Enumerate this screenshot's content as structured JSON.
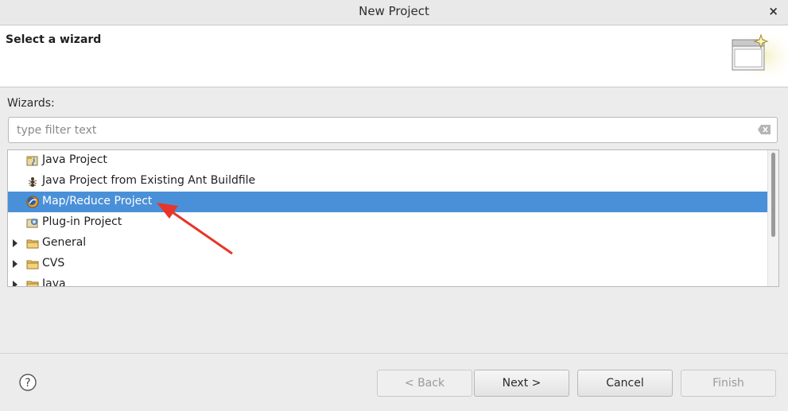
{
  "window": {
    "title": "New Project",
    "close_glyph": "×"
  },
  "header": {
    "heading": "Select a wizard",
    "banner_icon": "new-wizard-banner-icon"
  },
  "wizards_label": "Wizards:",
  "filter": {
    "value": "",
    "placeholder": "type filter text",
    "clear_icon": "clear-icon"
  },
  "tree": {
    "items": [
      {
        "label": "Java Project",
        "icon": "java-project-icon",
        "expandable": false,
        "selected": false
      },
      {
        "label": "Java Project from Existing Ant Buildfile",
        "icon": "ant-icon",
        "expandable": false,
        "selected": false
      },
      {
        "label": "Map/Reduce Project",
        "icon": "mapreduce-project-icon",
        "expandable": false,
        "selected": true
      },
      {
        "label": "Plug-in Project",
        "icon": "plugin-project-icon",
        "expandable": false,
        "selected": false
      },
      {
        "label": "General",
        "icon": "folder-icon",
        "expandable": true,
        "selected": false
      },
      {
        "label": "CVS",
        "icon": "folder-icon",
        "expandable": true,
        "selected": false
      },
      {
        "label": "Java",
        "icon": "folder-icon",
        "expandable": true,
        "selected": false
      }
    ]
  },
  "buttons": {
    "back": {
      "label": "< Back",
      "enabled": false
    },
    "next": {
      "label": "Next >",
      "enabled": true
    },
    "cancel": {
      "label": "Cancel",
      "enabled": true
    },
    "finish": {
      "label": "Finish",
      "enabled": false
    }
  },
  "colors": {
    "selection": "#4a90d9",
    "annotation_arrow": "#e8352a"
  }
}
